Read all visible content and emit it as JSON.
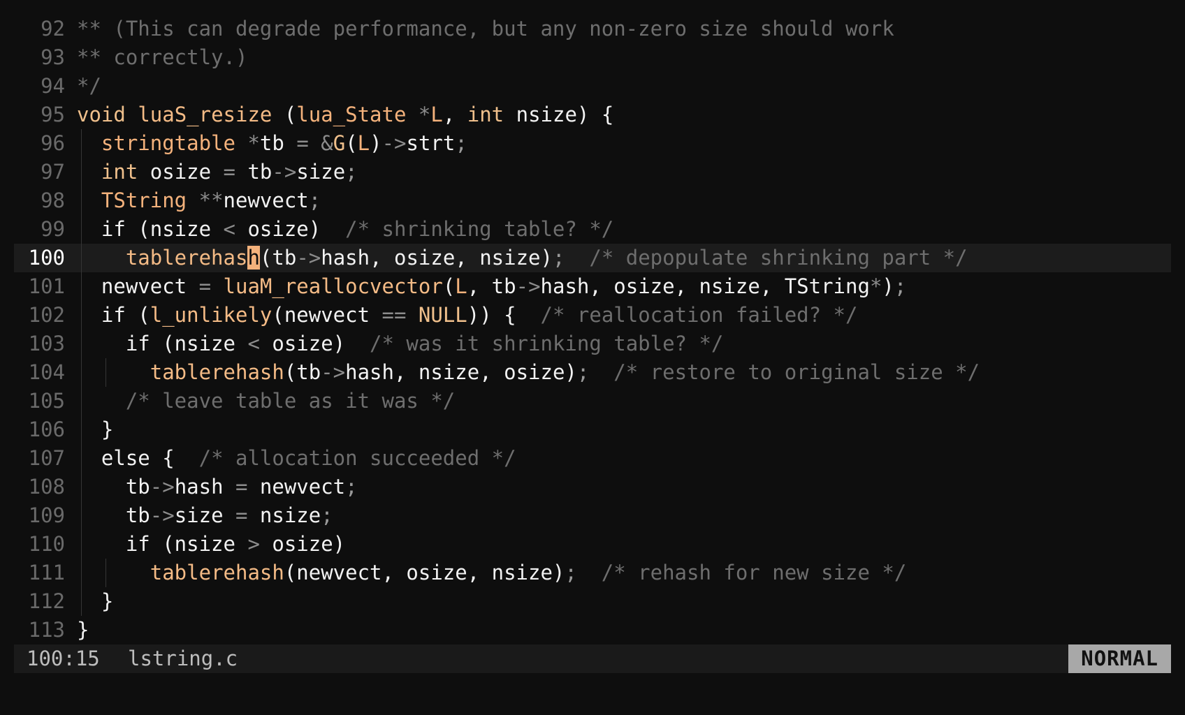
{
  "lines": [
    {
      "n": "92",
      "current": false,
      "guides": [],
      "tokens": [
        {
          "t": "** (This can degrade performance, but any non-zero size should work",
          "c": "cm"
        }
      ]
    },
    {
      "n": "93",
      "current": false,
      "guides": [],
      "tokens": [
        {
          "t": "** correctly.)",
          "c": "cm"
        }
      ]
    },
    {
      "n": "94",
      "current": false,
      "guides": [],
      "tokens": [
        {
          "t": "*/",
          "c": "cm"
        }
      ]
    },
    {
      "n": "95",
      "current": false,
      "guides": [],
      "tokens": [
        {
          "t": "void",
          "c": "kw"
        },
        {
          "t": " ",
          "c": "id"
        },
        {
          "t": "luaS_resize",
          "c": "fn"
        },
        {
          "t": " (",
          "c": "id"
        },
        {
          "t": "lua_State",
          "c": "ty"
        },
        {
          "t": " ",
          "c": "id"
        },
        {
          "t": "*",
          "c": "op"
        },
        {
          "t": "L",
          "c": "ty"
        },
        {
          "t": ", ",
          "c": "id"
        },
        {
          "t": "int",
          "c": "kw"
        },
        {
          "t": " nsize) {",
          "c": "id"
        }
      ]
    },
    {
      "n": "96",
      "current": false,
      "guides": [
        0
      ],
      "tokens": [
        {
          "t": "  ",
          "c": "id"
        },
        {
          "t": "stringtable",
          "c": "ty"
        },
        {
          "t": " ",
          "c": "id"
        },
        {
          "t": "*",
          "c": "op"
        },
        {
          "t": "tb ",
          "c": "id"
        },
        {
          "t": "=",
          "c": "op"
        },
        {
          "t": " ",
          "c": "id"
        },
        {
          "t": "&",
          "c": "op"
        },
        {
          "t": "G",
          "c": "mac"
        },
        {
          "t": "(",
          "c": "id"
        },
        {
          "t": "L",
          "c": "ty"
        },
        {
          "t": ")",
          "c": "id"
        },
        {
          "t": "->",
          "c": "op"
        },
        {
          "t": "strt",
          "c": "id"
        },
        {
          "t": ";",
          "c": "pu"
        }
      ]
    },
    {
      "n": "97",
      "current": false,
      "guides": [
        0
      ],
      "tokens": [
        {
          "t": "  ",
          "c": "id"
        },
        {
          "t": "int",
          "c": "kw"
        },
        {
          "t": " osize ",
          "c": "id"
        },
        {
          "t": "=",
          "c": "op"
        },
        {
          "t": " tb",
          "c": "id"
        },
        {
          "t": "->",
          "c": "op"
        },
        {
          "t": "size",
          "c": "id"
        },
        {
          "t": ";",
          "c": "pu"
        }
      ]
    },
    {
      "n": "98",
      "current": false,
      "guides": [
        0
      ],
      "tokens": [
        {
          "t": "  ",
          "c": "id"
        },
        {
          "t": "TString",
          "c": "ty"
        },
        {
          "t": " ",
          "c": "id"
        },
        {
          "t": "**",
          "c": "op"
        },
        {
          "t": "newvect",
          "c": "id"
        },
        {
          "t": ";",
          "c": "pu"
        }
      ]
    },
    {
      "n": "99",
      "current": false,
      "guides": [
        0
      ],
      "tokens": [
        {
          "t": "  if (nsize ",
          "c": "id"
        },
        {
          "t": "<",
          "c": "op"
        },
        {
          "t": " osize)  ",
          "c": "id"
        },
        {
          "t": "/* shrinking table? */",
          "c": "cm"
        }
      ]
    },
    {
      "n": "100",
      "current": true,
      "guides": [
        0
      ],
      "tokens": [
        {
          "t": "    ",
          "c": "id"
        },
        {
          "t": "tablerehas",
          "c": "fn"
        },
        {
          "t": "h",
          "c": "cursor"
        },
        {
          "t": "(tb",
          "c": "id"
        },
        {
          "t": "->",
          "c": "op"
        },
        {
          "t": "hash, osize, nsize)",
          "c": "id"
        },
        {
          "t": ";",
          "c": "pu"
        },
        {
          "t": "  ",
          "c": "id"
        },
        {
          "t": "/* depopulate shrinking part */",
          "c": "cm"
        }
      ]
    },
    {
      "n": "101",
      "current": false,
      "guides": [
        0
      ],
      "tokens": [
        {
          "t": "  newvect ",
          "c": "id"
        },
        {
          "t": "=",
          "c": "op"
        },
        {
          "t": " ",
          "c": "id"
        },
        {
          "t": "luaM_reallocvector",
          "c": "fn"
        },
        {
          "t": "(",
          "c": "id"
        },
        {
          "t": "L",
          "c": "ty"
        },
        {
          "t": ", tb",
          "c": "id"
        },
        {
          "t": "->",
          "c": "op"
        },
        {
          "t": "hash, osize, nsize, TString",
          "c": "id"
        },
        {
          "t": "*",
          "c": "op"
        },
        {
          "t": ")",
          "c": "id"
        },
        {
          "t": ";",
          "c": "pu"
        }
      ]
    },
    {
      "n": "102",
      "current": false,
      "guides": [
        0
      ],
      "tokens": [
        {
          "t": "  if (",
          "c": "id"
        },
        {
          "t": "l_unlikely",
          "c": "fn"
        },
        {
          "t": "(newvect ",
          "c": "id"
        },
        {
          "t": "==",
          "c": "op"
        },
        {
          "t": " ",
          "c": "id"
        },
        {
          "t": "NULL",
          "c": "mac"
        },
        {
          "t": ")) {  ",
          "c": "id"
        },
        {
          "t": "/* reallocation failed? */",
          "c": "cm"
        }
      ]
    },
    {
      "n": "103",
      "current": false,
      "guides": [
        0
      ],
      "tokens": [
        {
          "t": "    if (nsize ",
          "c": "id"
        },
        {
          "t": "<",
          "c": "op"
        },
        {
          "t": " osize)  ",
          "c": "id"
        },
        {
          "t": "/* was it shrinking table? */",
          "c": "cm"
        }
      ]
    },
    {
      "n": "104",
      "current": false,
      "guides": [
        0,
        2
      ],
      "tokens": [
        {
          "t": "      ",
          "c": "id"
        },
        {
          "t": "tablerehash",
          "c": "fn"
        },
        {
          "t": "(tb",
          "c": "id"
        },
        {
          "t": "->",
          "c": "op"
        },
        {
          "t": "hash, nsize, osize)",
          "c": "id"
        },
        {
          "t": ";",
          "c": "pu"
        },
        {
          "t": "  ",
          "c": "id"
        },
        {
          "t": "/* restore to original size */",
          "c": "cm"
        }
      ]
    },
    {
      "n": "105",
      "current": false,
      "guides": [
        0
      ],
      "tokens": [
        {
          "t": "    ",
          "c": "id"
        },
        {
          "t": "/* leave table as it was */",
          "c": "cm"
        }
      ]
    },
    {
      "n": "106",
      "current": false,
      "guides": [
        0
      ],
      "tokens": [
        {
          "t": "  }",
          "c": "id"
        }
      ]
    },
    {
      "n": "107",
      "current": false,
      "guides": [
        0
      ],
      "tokens": [
        {
          "t": "  else {  ",
          "c": "id"
        },
        {
          "t": "/* allocation succeeded */",
          "c": "cm"
        }
      ]
    },
    {
      "n": "108",
      "current": false,
      "guides": [
        0
      ],
      "tokens": [
        {
          "t": "    tb",
          "c": "id"
        },
        {
          "t": "->",
          "c": "op"
        },
        {
          "t": "hash ",
          "c": "id"
        },
        {
          "t": "=",
          "c": "op"
        },
        {
          "t": " newvect",
          "c": "id"
        },
        {
          "t": ";",
          "c": "pu"
        }
      ]
    },
    {
      "n": "109",
      "current": false,
      "guides": [
        0
      ],
      "tokens": [
        {
          "t": "    tb",
          "c": "id"
        },
        {
          "t": "->",
          "c": "op"
        },
        {
          "t": "size ",
          "c": "id"
        },
        {
          "t": "=",
          "c": "op"
        },
        {
          "t": " nsize",
          "c": "id"
        },
        {
          "t": ";",
          "c": "pu"
        }
      ]
    },
    {
      "n": "110",
      "current": false,
      "guides": [
        0
      ],
      "tokens": [
        {
          "t": "    if (nsize ",
          "c": "id"
        },
        {
          "t": ">",
          "c": "op"
        },
        {
          "t": " osize)",
          "c": "id"
        }
      ]
    },
    {
      "n": "111",
      "current": false,
      "guides": [
        0,
        2
      ],
      "tokens": [
        {
          "t": "      ",
          "c": "id"
        },
        {
          "t": "tablerehash",
          "c": "fn"
        },
        {
          "t": "(newvect, osize, nsize)",
          "c": "id"
        },
        {
          "t": ";",
          "c": "pu"
        },
        {
          "t": "  ",
          "c": "id"
        },
        {
          "t": "/* rehash for new size */",
          "c": "cm"
        }
      ]
    },
    {
      "n": "112",
      "current": false,
      "guides": [
        0
      ],
      "tokens": [
        {
          "t": "  }",
          "c": "id"
        }
      ]
    },
    {
      "n": "113",
      "current": false,
      "guides": [],
      "tokens": [
        {
          "t": "}",
          "c": "id"
        }
      ]
    }
  ],
  "status": {
    "position": "100:15",
    "filename": "lstring.c",
    "mode": "NORMAL"
  }
}
